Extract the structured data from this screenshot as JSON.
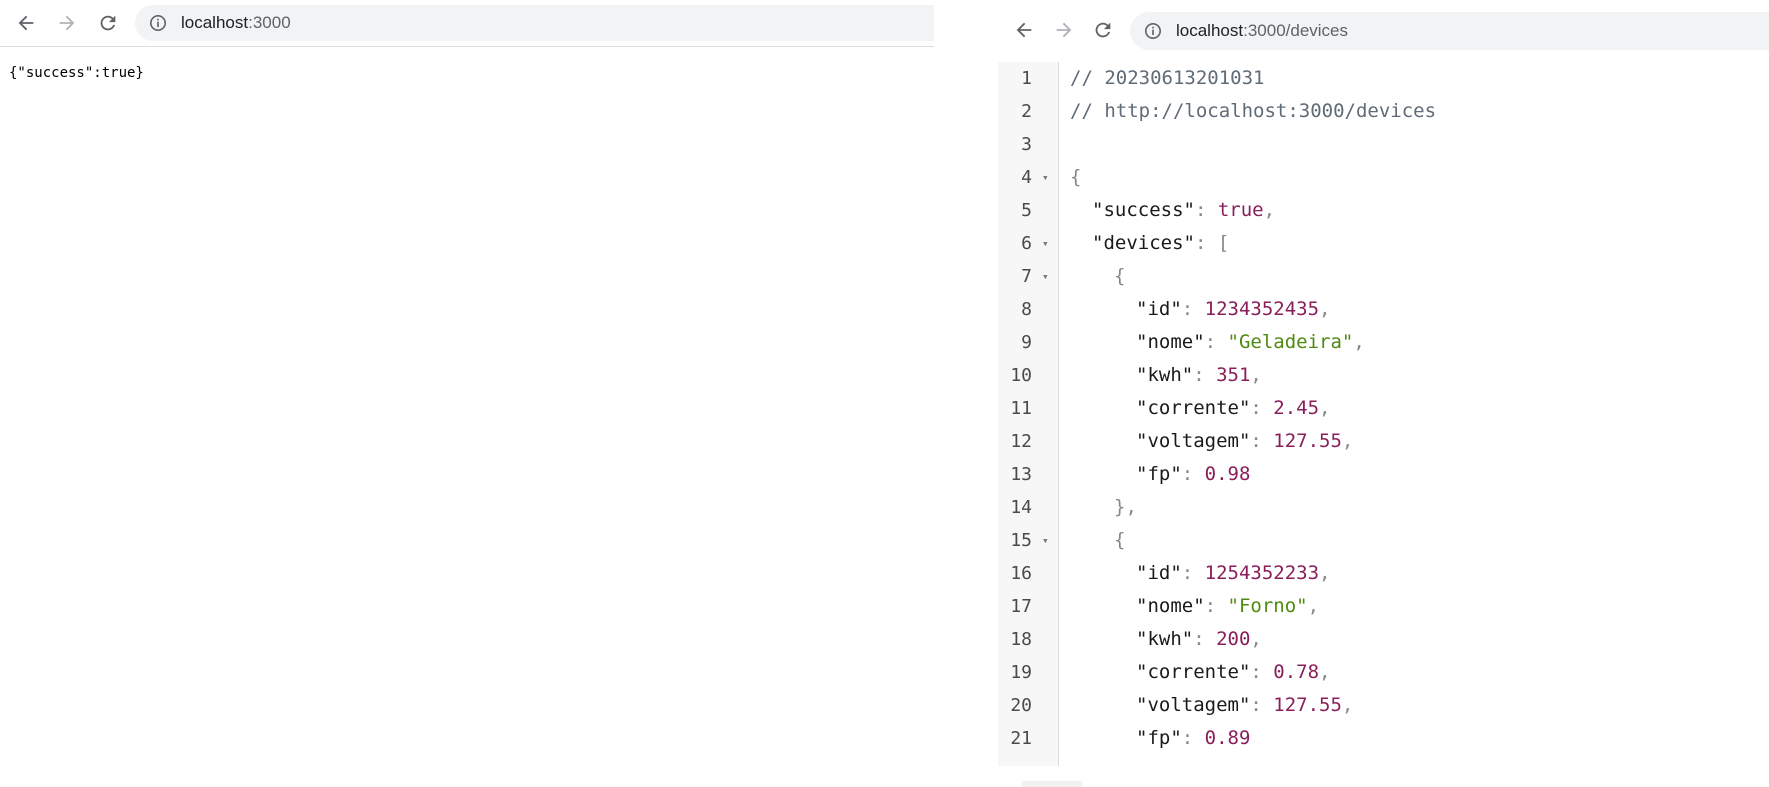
{
  "left_browser": {
    "url_host": "localhost",
    "url_rest": ":3000",
    "body_text": "{\"success\":true}"
  },
  "right_browser": {
    "url_host": "localhost",
    "url_rest": ":3000/devices",
    "lines": [
      {
        "n": "1",
        "fold": false,
        "indent": 0,
        "parts": [
          [
            "comment",
            "// 20230613201031"
          ]
        ]
      },
      {
        "n": "2",
        "fold": false,
        "indent": 0,
        "parts": [
          [
            "comment",
            "// http://localhost:3000/devices"
          ]
        ]
      },
      {
        "n": "3",
        "fold": false,
        "indent": 0,
        "parts": []
      },
      {
        "n": "4",
        "fold": true,
        "indent": 0,
        "parts": [
          [
            "punc",
            "{"
          ]
        ]
      },
      {
        "n": "5",
        "fold": false,
        "indent": 1,
        "parts": [
          [
            "key",
            "\"success\""
          ],
          [
            "punc",
            ": "
          ],
          [
            "bool",
            "true"
          ],
          [
            "punc",
            ","
          ]
        ]
      },
      {
        "n": "6",
        "fold": true,
        "indent": 1,
        "parts": [
          [
            "key",
            "\"devices\""
          ],
          [
            "punc",
            ": ["
          ]
        ]
      },
      {
        "n": "7",
        "fold": true,
        "indent": 2,
        "parts": [
          [
            "punc",
            "{"
          ]
        ]
      },
      {
        "n": "8",
        "fold": false,
        "indent": 3,
        "parts": [
          [
            "key",
            "\"id\""
          ],
          [
            "punc",
            ": "
          ],
          [
            "num",
            "1234352435"
          ],
          [
            "punc",
            ","
          ]
        ]
      },
      {
        "n": "9",
        "fold": false,
        "indent": 3,
        "parts": [
          [
            "key",
            "\"nome\""
          ],
          [
            "punc",
            ": "
          ],
          [
            "str",
            "\"Geladeira\""
          ],
          [
            "punc",
            ","
          ]
        ]
      },
      {
        "n": "10",
        "fold": false,
        "indent": 3,
        "parts": [
          [
            "key",
            "\"kwh\""
          ],
          [
            "punc",
            ": "
          ],
          [
            "num",
            "351"
          ],
          [
            "punc",
            ","
          ]
        ]
      },
      {
        "n": "11",
        "fold": false,
        "indent": 3,
        "parts": [
          [
            "key",
            "\"corrente\""
          ],
          [
            "punc",
            ": "
          ],
          [
            "num",
            "2.45"
          ],
          [
            "punc",
            ","
          ]
        ]
      },
      {
        "n": "12",
        "fold": false,
        "indent": 3,
        "parts": [
          [
            "key",
            "\"voltagem\""
          ],
          [
            "punc",
            ": "
          ],
          [
            "num",
            "127.55"
          ],
          [
            "punc",
            ","
          ]
        ]
      },
      {
        "n": "13",
        "fold": false,
        "indent": 3,
        "parts": [
          [
            "key",
            "\"fp\""
          ],
          [
            "punc",
            ": "
          ],
          [
            "num",
            "0.98"
          ]
        ]
      },
      {
        "n": "14",
        "fold": false,
        "indent": 2,
        "parts": [
          [
            "punc",
            "},"
          ]
        ]
      },
      {
        "n": "15",
        "fold": true,
        "indent": 2,
        "parts": [
          [
            "punc",
            "{"
          ]
        ]
      },
      {
        "n": "16",
        "fold": false,
        "indent": 3,
        "parts": [
          [
            "key",
            "\"id\""
          ],
          [
            "punc",
            ": "
          ],
          [
            "num",
            "1254352233"
          ],
          [
            "punc",
            ","
          ]
        ]
      },
      {
        "n": "17",
        "fold": false,
        "indent": 3,
        "parts": [
          [
            "key",
            "\"nome\""
          ],
          [
            "punc",
            ": "
          ],
          [
            "str",
            "\"Forno\""
          ],
          [
            "punc",
            ","
          ]
        ]
      },
      {
        "n": "18",
        "fold": false,
        "indent": 3,
        "parts": [
          [
            "key",
            "\"kwh\""
          ],
          [
            "punc",
            ": "
          ],
          [
            "num",
            "200"
          ],
          [
            "punc",
            ","
          ]
        ]
      },
      {
        "n": "19",
        "fold": false,
        "indent": 3,
        "parts": [
          [
            "key",
            "\"corrente\""
          ],
          [
            "punc",
            ": "
          ],
          [
            "num",
            "0.78"
          ],
          [
            "punc",
            ","
          ]
        ]
      },
      {
        "n": "20",
        "fold": false,
        "indent": 3,
        "parts": [
          [
            "key",
            "\"voltagem\""
          ],
          [
            "punc",
            ": "
          ],
          [
            "num",
            "127.55"
          ],
          [
            "punc",
            ","
          ]
        ]
      },
      {
        "n": "21",
        "fold": false,
        "indent": 3,
        "parts": [
          [
            "key",
            "\"fp\""
          ],
          [
            "punc",
            ": "
          ],
          [
            "num",
            "0.89"
          ]
        ]
      }
    ]
  },
  "icons": {
    "back": "arrow-left-icon",
    "forward": "arrow-right-icon",
    "reload": "reload-icon",
    "info": "info-icon",
    "fold": "fold-triangle-icon"
  }
}
